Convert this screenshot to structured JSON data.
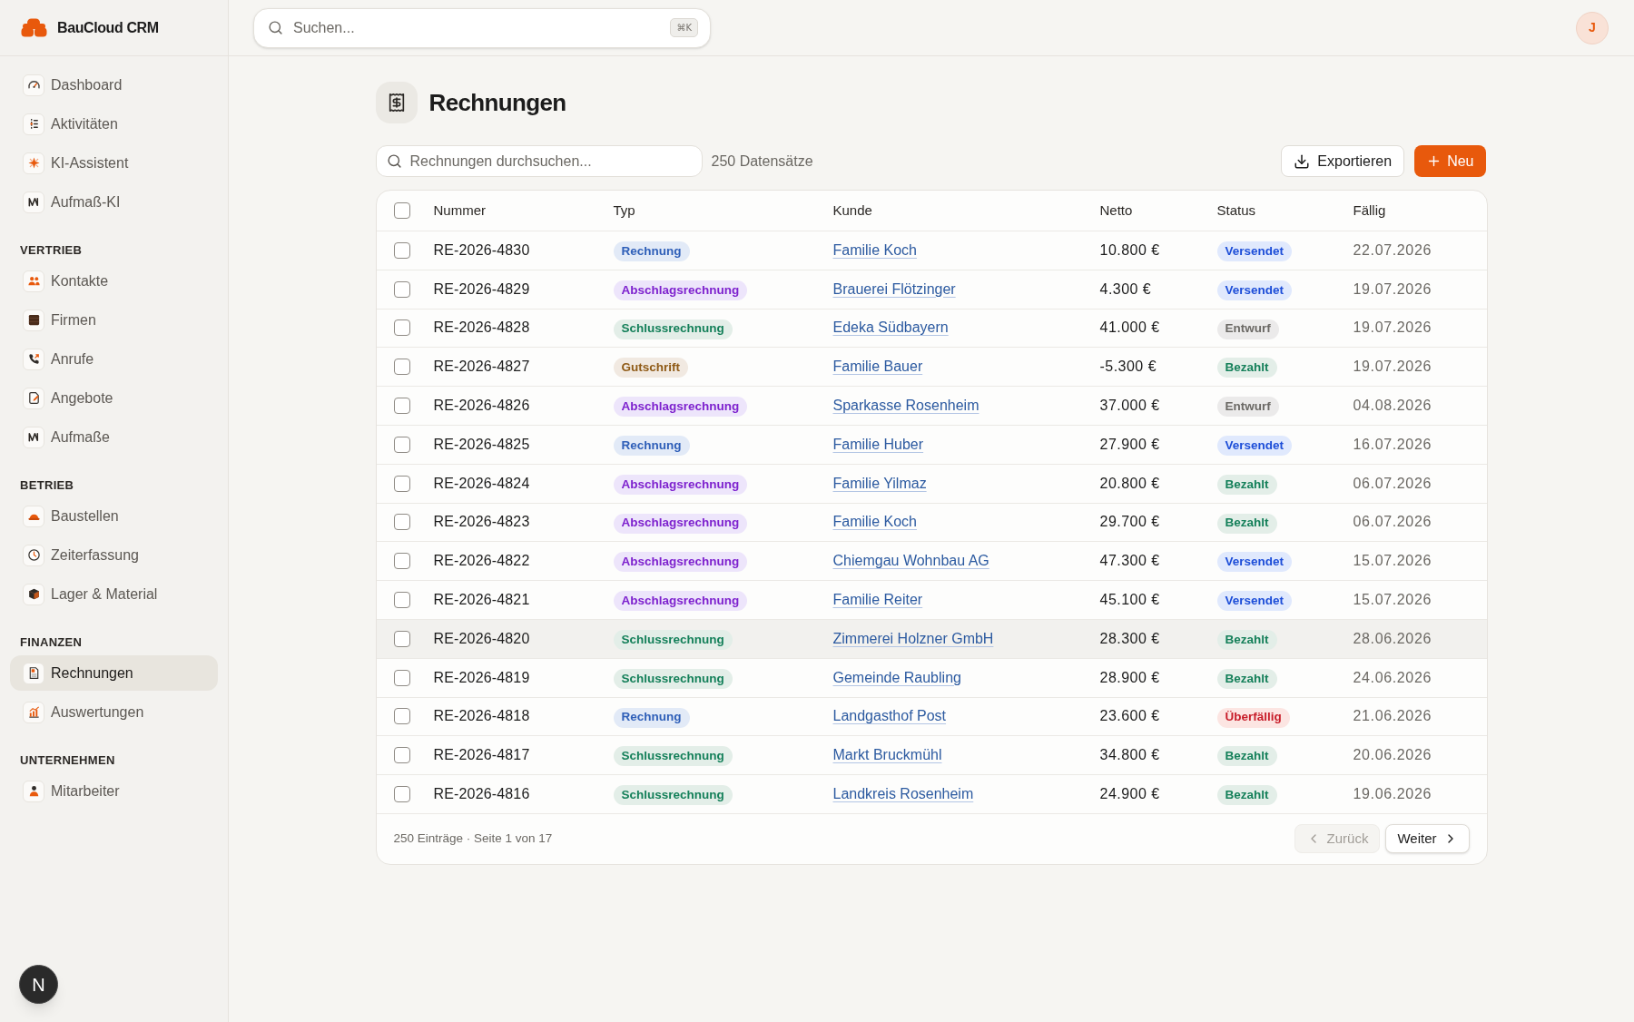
{
  "app": {
    "name": "BauCloud CRM"
  },
  "sidebar": {
    "sections": [
      {
        "items": [
          {
            "label": "Dashboard",
            "selected": false
          },
          {
            "label": "Aktivitäten",
            "selected": false
          },
          {
            "label": "KI-Assistent",
            "selected": false
          },
          {
            "label": "Aufmaß-KI",
            "selected": false
          }
        ]
      },
      {
        "title": "VERTRIEB",
        "items": [
          {
            "label": "Kontakte",
            "selected": false
          },
          {
            "label": "Firmen",
            "selected": false
          },
          {
            "label": "Anrufe",
            "selected": false
          },
          {
            "label": "Angebote",
            "selected": false
          },
          {
            "label": "Aufmaße",
            "selected": false
          }
        ]
      },
      {
        "title": "BETRIEB",
        "items": [
          {
            "label": "Baustellen",
            "selected": false
          },
          {
            "label": "Zeiterfassung",
            "selected": false
          },
          {
            "label": "Lager & Material",
            "selected": false
          }
        ]
      },
      {
        "title": "FINANZEN",
        "items": [
          {
            "label": "Rechnungen",
            "selected": true
          },
          {
            "label": "Auswertungen",
            "selected": false
          }
        ]
      },
      {
        "title": "UNTERNEHMEN",
        "items": [
          {
            "label": "Mitarbeiter",
            "selected": false
          }
        ]
      }
    ]
  },
  "dev_indicator": {
    "label": "N"
  },
  "topbar": {
    "search": {
      "placeholder": "Suchen...",
      "shortcut": "⌘K"
    },
    "avatar": {
      "initial": "J"
    }
  },
  "page": {
    "title": "Rechnungen",
    "search": {
      "placeholder": "Rechnungen durchsuchen..."
    },
    "record_count": "250 Datensätze",
    "buttons": [
      {
        "label": "Exportieren",
        "kind": "export"
      },
      {
        "label": "Neu",
        "kind": "create"
      }
    ]
  },
  "table": {
    "select_all": {
      "checked": false
    },
    "columns": [
      "Nummer",
      "Typ",
      "Kunde",
      "Netto",
      "Status",
      "Fällig"
    ],
    "rows": [
      {
        "number": "RE-2026-4830",
        "type": {
          "label": "Rechnung",
          "color": "#2f5fb8"
        },
        "customer": "Familie Koch",
        "net": "10.800 €",
        "status": {
          "label": "Versendet",
          "color": "#1d4ed8"
        },
        "due": "22.07.2026",
        "checked": false,
        "hovered": false
      },
      {
        "number": "RE-2026-4829",
        "type": {
          "label": "Abschlagsrechnung",
          "color": "#7e22ce"
        },
        "customer": "Brauerei Flötzinger",
        "net": "4.300 €",
        "status": {
          "label": "Versendet",
          "color": "#1d4ed8"
        },
        "due": "19.07.2026",
        "checked": false,
        "hovered": false
      },
      {
        "number": "RE-2026-4828",
        "type": {
          "label": "Schlussrechnung",
          "color": "#15805a"
        },
        "customer": "Edeka Südbayern",
        "net": "41.000 €",
        "status": {
          "label": "Entwurf",
          "color": "#6b6965"
        },
        "due": "19.07.2026",
        "checked": false,
        "hovered": false
      },
      {
        "number": "RE-2026-4827",
        "type": {
          "label": "Gutschrift",
          "color": "#8f5a16"
        },
        "customer": "Familie Bauer",
        "net": "-5.300 €",
        "status": {
          "label": "Bezahlt",
          "color": "#15805a"
        },
        "due": "19.07.2026",
        "checked": false,
        "hovered": false
      },
      {
        "number": "RE-2026-4826",
        "type": {
          "label": "Abschlagsrechnung",
          "color": "#7e22ce"
        },
        "customer": "Sparkasse Rosenheim",
        "net": "37.000 €",
        "status": {
          "label": "Entwurf",
          "color": "#6b6965"
        },
        "due": "04.08.2026",
        "checked": false,
        "hovered": false
      },
      {
        "number": "RE-2026-4825",
        "type": {
          "label": "Rechnung",
          "color": "#2f5fb8"
        },
        "customer": "Familie Huber",
        "net": "27.900 €",
        "status": {
          "label": "Versendet",
          "color": "#1d4ed8"
        },
        "due": "16.07.2026",
        "checked": false,
        "hovered": false
      },
      {
        "number": "RE-2026-4824",
        "type": {
          "label": "Abschlagsrechnung",
          "color": "#7e22ce"
        },
        "customer": "Familie Yilmaz",
        "net": "20.800 €",
        "status": {
          "label": "Bezahlt",
          "color": "#15805a"
        },
        "due": "06.07.2026",
        "checked": false,
        "hovered": false
      },
      {
        "number": "RE-2026-4823",
        "type": {
          "label": "Abschlagsrechnung",
          "color": "#7e22ce"
        },
        "customer": "Familie Koch",
        "net": "29.700 €",
        "status": {
          "label": "Bezahlt",
          "color": "#15805a"
        },
        "due": "06.07.2026",
        "checked": false,
        "hovered": false
      },
      {
        "number": "RE-2026-4822",
        "type": {
          "label": "Abschlagsrechnung",
          "color": "#7e22ce"
        },
        "customer": "Chiemgau Wohnbau AG",
        "net": "47.300 €",
        "status": {
          "label": "Versendet",
          "color": "#1d4ed8"
        },
        "due": "15.07.2026",
        "checked": false,
        "hovered": false
      },
      {
        "number": "RE-2026-4821",
        "type": {
          "label": "Abschlagsrechnung",
          "color": "#7e22ce"
        },
        "customer": "Familie Reiter",
        "net": "45.100 €",
        "status": {
          "label": "Versendet",
          "color": "#1d4ed8"
        },
        "due": "15.07.2026",
        "checked": false,
        "hovered": false
      },
      {
        "number": "RE-2026-4820",
        "type": {
          "label": "Schlussrechnung",
          "color": "#15805a"
        },
        "customer": "Zimmerei Holzner GmbH",
        "net": "28.300 €",
        "status": {
          "label": "Bezahlt",
          "color": "#15805a"
        },
        "due": "28.06.2026",
        "checked": false,
        "hovered": true
      },
      {
        "number": "RE-2026-4819",
        "type": {
          "label": "Schlussrechnung",
          "color": "#15805a"
        },
        "customer": "Gemeinde Raubling",
        "net": "28.900 €",
        "status": {
          "label": "Bezahlt",
          "color": "#15805a"
        },
        "due": "24.06.2026",
        "checked": false,
        "hovered": false
      },
      {
        "number": "RE-2026-4818",
        "type": {
          "label": "Rechnung",
          "color": "#2f5fb8"
        },
        "customer": "Landgasthof Post",
        "net": "23.600 €",
        "status": {
          "label": "Überfällig",
          "color": "#c81e2a"
        },
        "due": "21.06.2026",
        "checked": false,
        "hovered": false
      },
      {
        "number": "RE-2026-4817",
        "type": {
          "label": "Schlussrechnung",
          "color": "#15805a"
        },
        "customer": "Markt Bruckmühl",
        "net": "34.800 €",
        "status": {
          "label": "Bezahlt",
          "color": "#15805a"
        },
        "due": "20.06.2026",
        "checked": false,
        "hovered": false
      },
      {
        "number": "RE-2026-4816",
        "type": {
          "label": "Schlussrechnung",
          "color": "#15805a"
        },
        "customer": "Landkreis Rosenheim",
        "net": "24.900 €",
        "status": {
          "label": "Bezahlt",
          "color": "#15805a"
        },
        "due": "19.06.2026",
        "checked": false,
        "hovered": false
      }
    ]
  },
  "pagination": {
    "summary": "250 Einträge · Seite 1 von 17",
    "buttons": [
      {
        "label": "Zurück",
        "kind": "prev",
        "disabled": true
      },
      {
        "label": "Weiter",
        "kind": "next",
        "disabled": false
      }
    ]
  }
}
